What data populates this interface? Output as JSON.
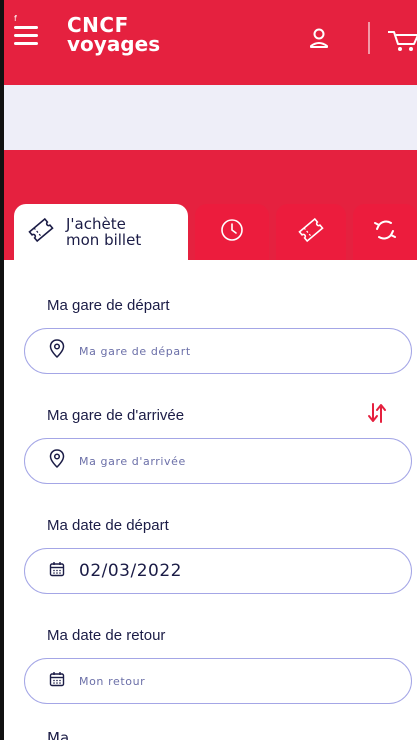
{
  "header": {
    "menu_label": "f",
    "logo_line1": "CNCF",
    "logo_line2": "voyages",
    "brand_color": "#e5213f"
  },
  "tabs": [
    {
      "label": "J'achète mon billet",
      "icon": "ticket-icon",
      "active": true
    },
    {
      "label": "",
      "icon": "clock-icon",
      "active": false
    },
    {
      "label": "",
      "icon": "ticket-icon",
      "active": false
    },
    {
      "label": "",
      "icon": "exchange-icon",
      "active": false
    }
  ],
  "tab_active_line1": "J'achète",
  "tab_active_line2": "mon billet",
  "form": {
    "departure": {
      "label": "Ma gare de départ",
      "placeholder": "Ma gare de départ",
      "icon": "location-pin-icon"
    },
    "arrival": {
      "label": "Ma gare de d'arrivée",
      "placeholder": "Ma gare d'arrivée",
      "icon": "location-pin-icon"
    },
    "swap_icon": "swap-arrows-icon",
    "departure_date": {
      "label": "Ma date de départ",
      "value": "02/03/2022",
      "icon": "calendar-icon"
    },
    "return_date": {
      "label": "Ma date de retour",
      "placeholder": "Mon retour",
      "icon": "calendar-icon"
    },
    "next_label_partial": "Ma"
  },
  "colors": {
    "accent": "#e5213f",
    "text_dark": "#1b1c46",
    "input_border": "#a4a6e6",
    "banner_bg": "#eeeef8"
  }
}
